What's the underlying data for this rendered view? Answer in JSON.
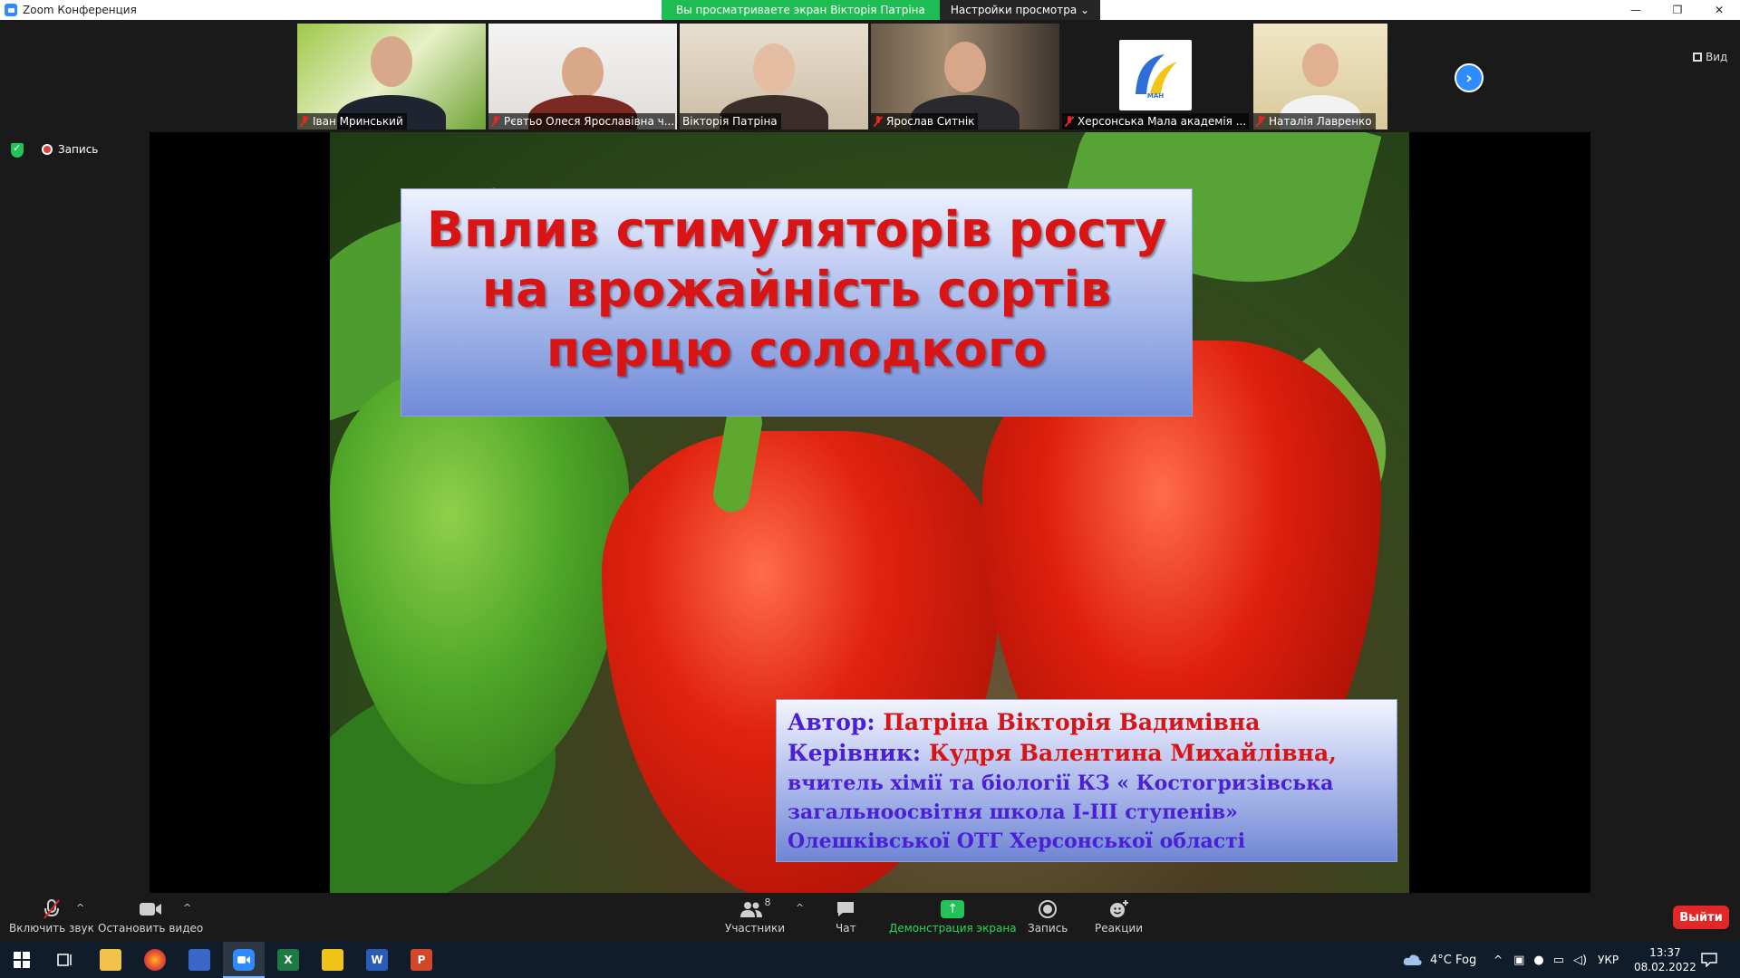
{
  "window": {
    "title": "Zoom Конференция"
  },
  "share_banner": {
    "viewing_text": "Вы просматриваете экран Вікторія Патріна",
    "settings_label": "Настройки просмотра ⌄"
  },
  "window_controls": {
    "minimize": "—",
    "restore": "❐",
    "close": "✕"
  },
  "participants": [
    {
      "name": "Іван Мринський",
      "muted": true
    },
    {
      "name": "Рєвтьо Олеся Ярославівна ч...",
      "muted": true
    },
    {
      "name": "Вікторія Патріна",
      "muted": false
    },
    {
      "name": "Ярослав Ситнік",
      "muted": true
    },
    {
      "name": "Херсонська Мала академія ...",
      "muted": true
    },
    {
      "name": "Наталія Лавренко",
      "muted": true
    }
  ],
  "logo_text": "МАН",
  "view_button": {
    "label": "Вид"
  },
  "recording_indicator": {
    "label": "Запись"
  },
  "slide": {
    "title_lines": [
      "Вплив стимуляторів росту",
      "на врожайність сортів",
      "перцю солодкого"
    ],
    "author_label": "Автор:",
    "author_name": "Патріна Вікторія Вадимівна",
    "supervisor_label": "Керівник:",
    "supervisor_name": "Кудря Валентина Михайлівна,",
    "supervisor_desc": "вчитель хімії та біології КЗ « Костогризівська загальноосвітня школа І-ІІІ ступенів» Олешківської ОТГ Херсонської області"
  },
  "toolbar": {
    "unmute_label": "Включить звук",
    "stop_video_label": "Остановить видео",
    "participants_label": "Участники",
    "participants_count": "8",
    "chat_label": "Чат",
    "share_label": "Демонстрация экрана",
    "record_label": "Запись",
    "reactions_label": "Реакции",
    "leave_label": "Выйти"
  },
  "taskbar": {
    "weather": "4°C  Fog",
    "language": "УКР",
    "time": "13:37",
    "date": "08.02.2022"
  },
  "colors": {
    "zoom_blue": "#2d8cff",
    "share_green": "#23d959",
    "leave_red": "#e02828",
    "title_red": "#d81414",
    "label_purple": "#4a1fd6"
  }
}
